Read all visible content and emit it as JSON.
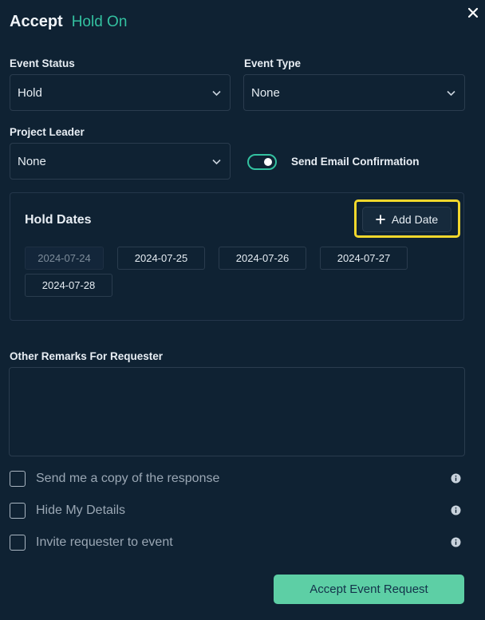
{
  "header": {
    "title": "Accept",
    "status": "Hold On"
  },
  "colors": {
    "accent": "#33c1a0",
    "button": "#5dcfa5",
    "highlight": "#f2d72c",
    "background": "#0f2233"
  },
  "event_status": {
    "label": "Event Status",
    "value": "Hold"
  },
  "event_type": {
    "label": "Event Type",
    "value": "None"
  },
  "project_leader": {
    "label": "Project Leader",
    "value": "None"
  },
  "email_toggle": {
    "label": "Send Email Confirmation",
    "enabled": true
  },
  "hold_dates": {
    "title": "Hold Dates",
    "add_label": "Add Date",
    "dates": [
      "2024-07-24",
      "2024-07-25",
      "2024-07-26",
      "2024-07-27",
      "2024-07-28"
    ]
  },
  "remarks": {
    "label": "Other Remarks For Requester",
    "value": "",
    "placeholder": ""
  },
  "options": [
    {
      "label": "Send me a copy of the response",
      "checked": false
    },
    {
      "label": "Hide My Details",
      "checked": false
    },
    {
      "label": "Invite requester to event",
      "checked": false
    }
  ],
  "submit": {
    "label": "Accept Event Request"
  }
}
